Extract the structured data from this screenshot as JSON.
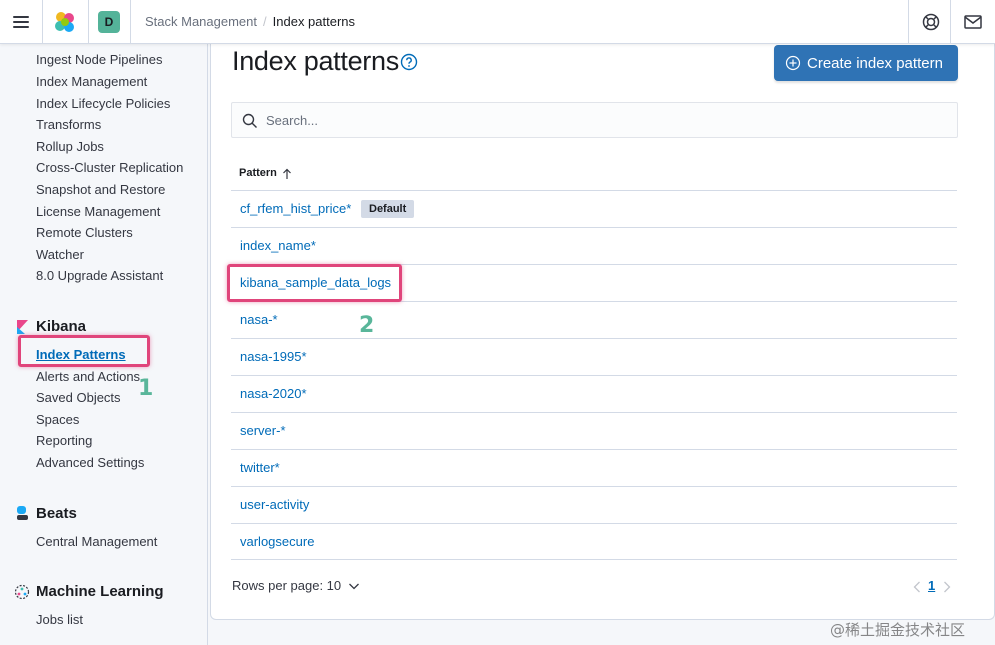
{
  "header": {
    "space_initial": "D",
    "space_color": "#54b399",
    "breadcrumbs": [
      {
        "label": "Stack Management"
      },
      {
        "label": "Index patterns"
      }
    ]
  },
  "sidebar": {
    "items": [
      "Ingest Node Pipelines",
      "Index Management",
      "Index Lifecycle Policies",
      "Transforms",
      "Rollup Jobs",
      "Cross-Cluster Replication",
      "Snapshot and Restore",
      "License Management",
      "Remote Clusters",
      "Watcher",
      "8.0 Upgrade Assistant"
    ],
    "kibana": {
      "title": "Kibana",
      "items": [
        "Index Patterns",
        "Alerts and Actions",
        "Saved Objects",
        "Spaces",
        "Reporting",
        "Advanced Settings"
      ],
      "active": "Index Patterns"
    },
    "beats": {
      "title": "Beats",
      "items": [
        "Central Management"
      ]
    },
    "ml": {
      "title": "Machine Learning",
      "items": [
        "Jobs list"
      ]
    }
  },
  "main": {
    "title": "Index patterns",
    "create_button": "Create index pattern",
    "search_placeholder": "Search...",
    "column_header": "Pattern",
    "default_badge": "Default",
    "patterns": [
      "cf_rfem_hist_price*",
      "index_name*",
      "kibana_sample_data_logs",
      "nasa-*",
      "nasa-1995*",
      "nasa-2020*",
      "server-*",
      "twitter*",
      "user-activity",
      "varlogsecure"
    ],
    "rows_per_page": "Rows per page: 10",
    "current_page": "1"
  },
  "annotations": {
    "step1": "1",
    "step2": "2",
    "color": "#e0457b"
  },
  "watermark": "@稀土掘金技术社区",
  "colors": {
    "link": "#006bb8",
    "primary": "#2f73b5",
    "accent": "#e0457b"
  }
}
